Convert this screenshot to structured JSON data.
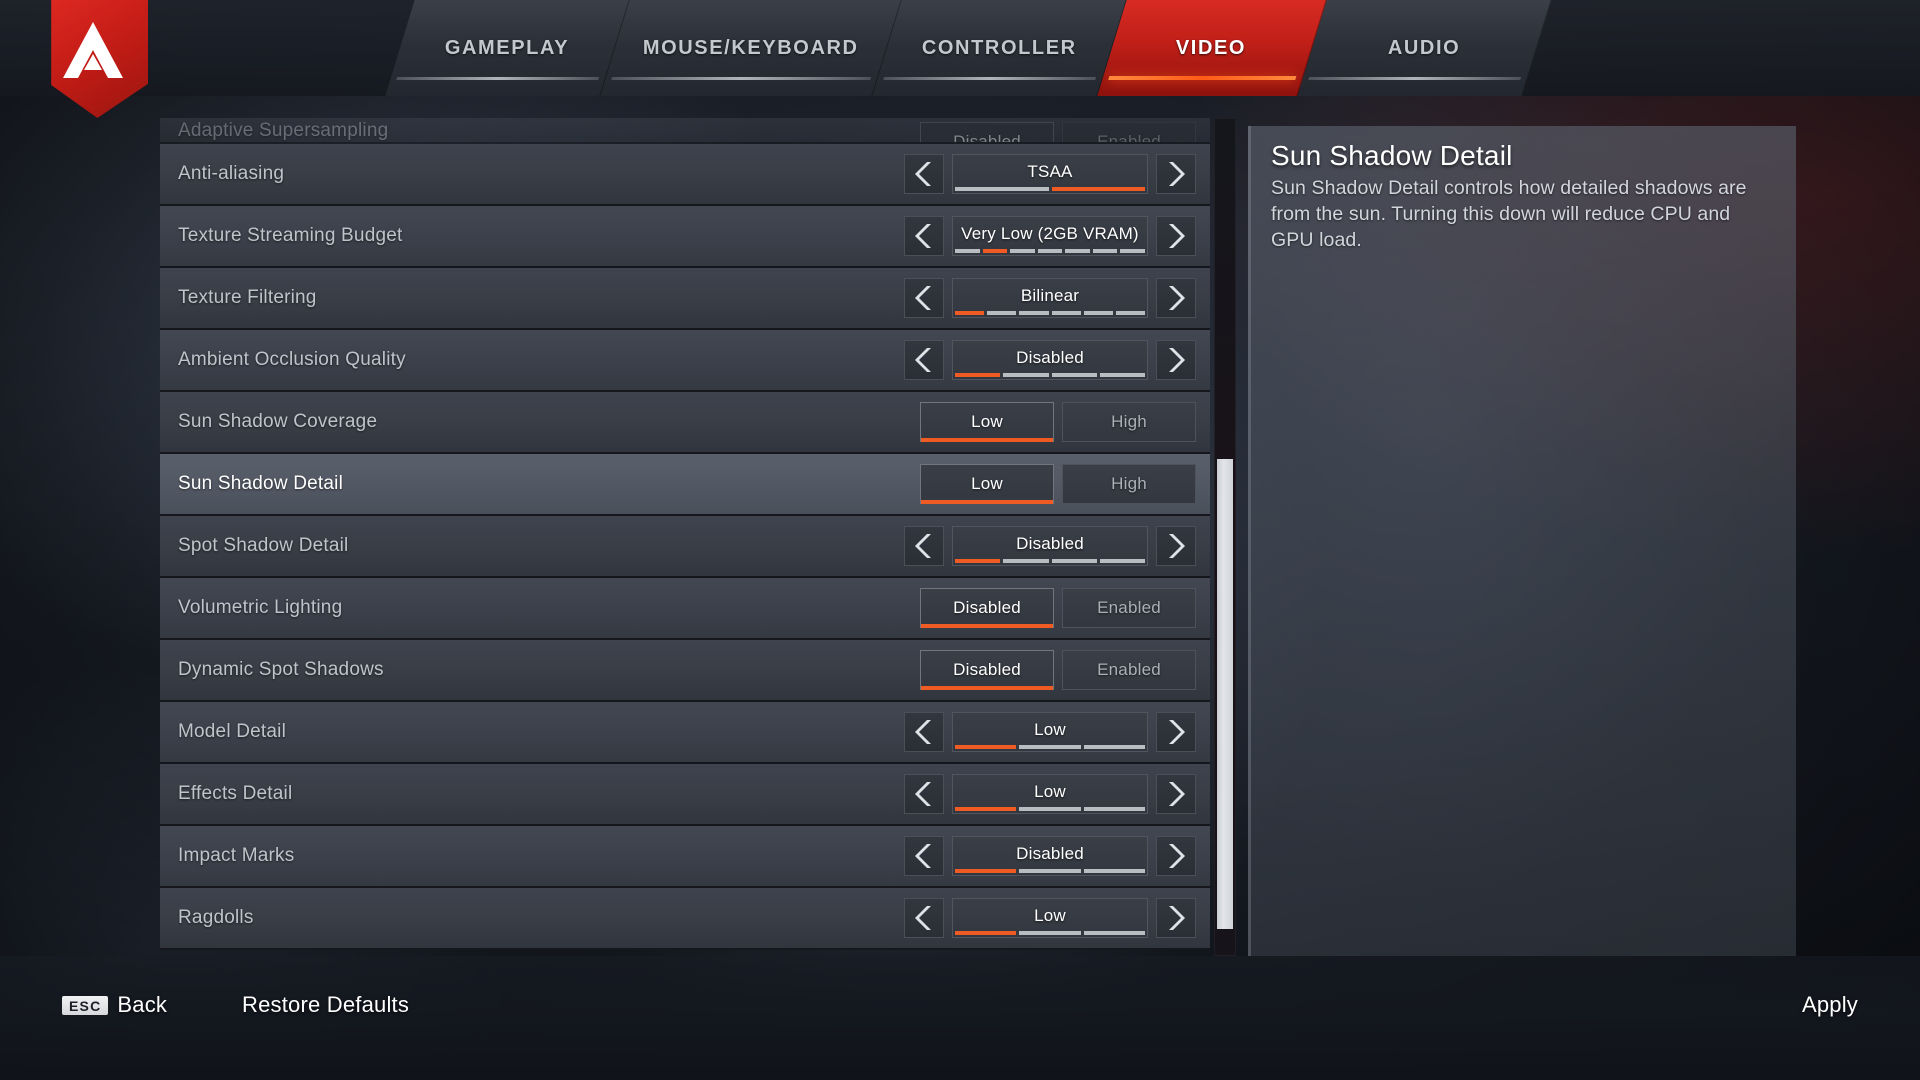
{
  "app": {
    "logo_name": "apex-legends-logo",
    "accent_orange": "#ef5b22",
    "accent_red": "#c01f18"
  },
  "header": {
    "tabs": [
      {
        "label": "GAMEPLAY",
        "active": false
      },
      {
        "label": "MOUSE/KEYBOARD",
        "active": false
      },
      {
        "label": "CONTROLLER",
        "active": false
      },
      {
        "label": "VIDEO",
        "active": true
      },
      {
        "label": "AUDIO",
        "active": false
      }
    ]
  },
  "settings": {
    "rows": [
      {
        "label": "Adaptive Supersampling",
        "type": "toggle",
        "options": [
          "Disabled",
          "Enabled"
        ],
        "selected_index": 0,
        "clipped": true,
        "highlighted": false
      },
      {
        "label": "Anti-aliasing",
        "type": "spinner",
        "value": "TSAA",
        "segments": 2,
        "active_segment": 2,
        "clipped": false,
        "highlighted": false
      },
      {
        "label": "Texture Streaming Budget",
        "type": "spinner",
        "value": "Very Low (2GB VRAM)",
        "segments": 7,
        "active_segment": 2,
        "clipped": false,
        "highlighted": false
      },
      {
        "label": "Texture Filtering",
        "type": "spinner",
        "value": "Bilinear",
        "segments": 6,
        "active_segment": 1,
        "clipped": false,
        "highlighted": false
      },
      {
        "label": "Ambient Occlusion Quality",
        "type": "spinner",
        "value": "Disabled",
        "segments": 4,
        "active_segment": 1,
        "clipped": false,
        "highlighted": false
      },
      {
        "label": "Sun Shadow Coverage",
        "type": "toggle",
        "options": [
          "Low",
          "High"
        ],
        "selected_index": 0,
        "clipped": false,
        "highlighted": false
      },
      {
        "label": "Sun Shadow Detail",
        "type": "toggle",
        "options": [
          "Low",
          "High"
        ],
        "selected_index": 0,
        "clipped": false,
        "highlighted": true
      },
      {
        "label": "Spot Shadow Detail",
        "type": "spinner",
        "value": "Disabled",
        "segments": 4,
        "active_segment": 1,
        "clipped": false,
        "highlighted": false
      },
      {
        "label": "Volumetric Lighting",
        "type": "toggle",
        "options": [
          "Disabled",
          "Enabled"
        ],
        "selected_index": 0,
        "clipped": false,
        "highlighted": false
      },
      {
        "label": "Dynamic Spot Shadows",
        "type": "toggle",
        "options": [
          "Disabled",
          "Enabled"
        ],
        "selected_index": 0,
        "clipped": false,
        "highlighted": false
      },
      {
        "label": "Model Detail",
        "type": "spinner",
        "value": "Low",
        "segments": 3,
        "active_segment": 1,
        "clipped": false,
        "highlighted": false
      },
      {
        "label": "Effects Detail",
        "type": "spinner",
        "value": "Low",
        "segments": 3,
        "active_segment": 1,
        "clipped": false,
        "highlighted": false
      },
      {
        "label": "Impact Marks",
        "type": "spinner",
        "value": "Disabled",
        "segments": 3,
        "active_segment": 1,
        "clipped": false,
        "highlighted": false
      },
      {
        "label": "Ragdolls",
        "type": "spinner",
        "value": "Low",
        "segments": 3,
        "active_segment": 1,
        "clipped": false,
        "highlighted": false
      }
    ]
  },
  "description": {
    "title": "Sun Shadow Detail",
    "body": "Sun Shadow Detail controls how detailed shadows are from the sun. Turning this down will reduce CPU and GPU load."
  },
  "footer": {
    "back_key": "ESC",
    "back_label": "Back",
    "restore_label": "Restore Defaults",
    "apply_label": "Apply"
  }
}
